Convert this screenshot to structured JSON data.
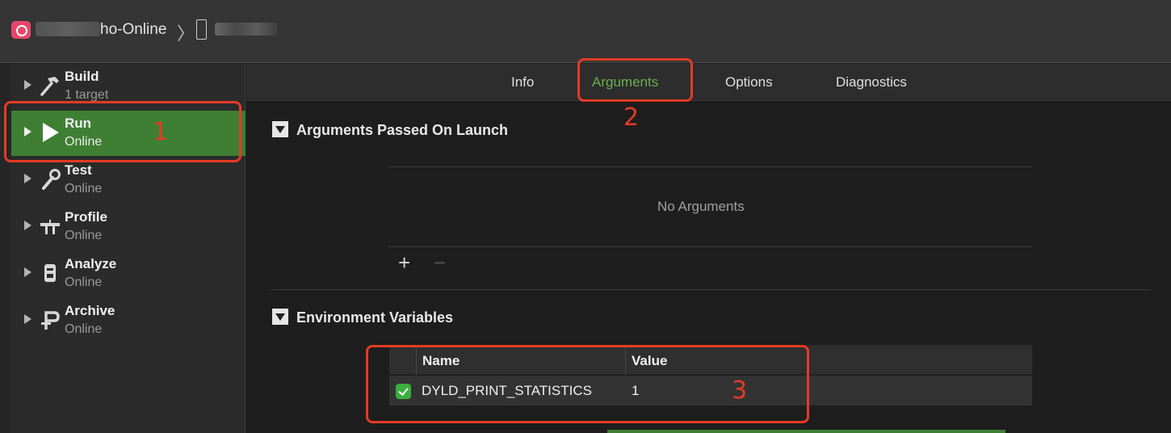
{
  "titlebar": {
    "scheme_name": "ho-Online",
    "separator": "〉"
  },
  "sidebar": {
    "items": [
      {
        "title": "Build",
        "subtitle": "1 target",
        "icon": "hammer-icon",
        "selected": false
      },
      {
        "title": "Run",
        "subtitle": "Online",
        "icon": "play-icon",
        "selected": true
      },
      {
        "title": "Test",
        "subtitle": "Online",
        "icon": "wrench-icon",
        "selected": false
      },
      {
        "title": "Profile",
        "subtitle": "Online",
        "icon": "caliper-icon",
        "selected": false
      },
      {
        "title": "Analyze",
        "subtitle": "Online",
        "icon": "analyze-icon",
        "selected": false
      },
      {
        "title": "Archive",
        "subtitle": "Online",
        "icon": "archive-icon",
        "selected": false
      }
    ]
  },
  "tabs": [
    {
      "label": "Info",
      "active": false
    },
    {
      "label": "Arguments",
      "active": true
    },
    {
      "label": "Options",
      "active": false
    },
    {
      "label": "Diagnostics",
      "active": false
    }
  ],
  "arguments_section": {
    "title": "Arguments Passed On Launch",
    "empty_text": "No Arguments",
    "add_label": "+",
    "remove_label": "−"
  },
  "env_section": {
    "title": "Environment Variables",
    "columns": {
      "name": "Name",
      "value": "Value"
    },
    "rows": [
      {
        "enabled": true,
        "name": "DYLD_PRINT_STATISTICS",
        "value": "1"
      }
    ]
  },
  "annotations": {
    "one": "1",
    "two": "2",
    "three": "3"
  },
  "colors": {
    "selection_green": "#3f7f33",
    "active_tab": "#6ab04c",
    "annotation_red": "#e53b25",
    "checkbox_green": "#3aae3e"
  }
}
